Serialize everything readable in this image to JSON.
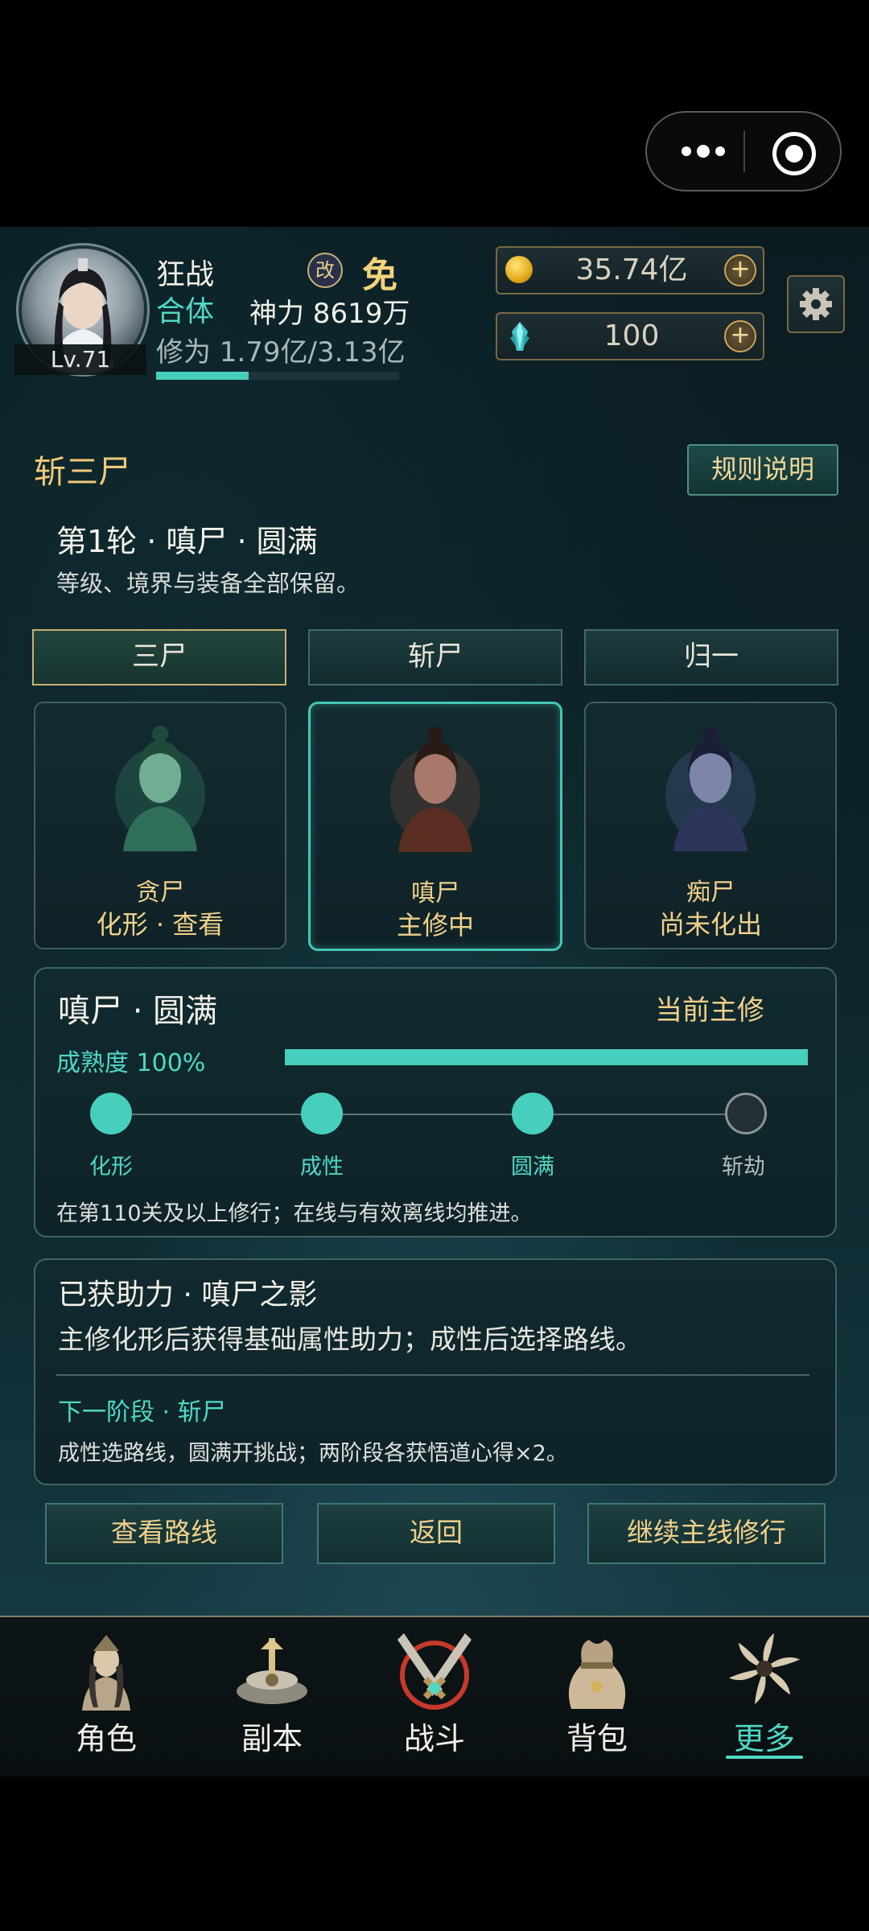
{
  "player": {
    "name": "狂战",
    "level": "Lv.71",
    "realm": "合体",
    "power": "神力 8619万",
    "cultivation": "修为 1.79亿/3.13亿",
    "cultivation_progress": 0.38,
    "gai_label": "改",
    "mian_label": "免"
  },
  "resources": {
    "gold": "35.74亿",
    "gems": "100",
    "plus": "+"
  },
  "section": {
    "title": "斩三尸",
    "rules_button": "规则说明",
    "round": "第1轮 · 嗔尸 · 圆满",
    "round_desc": "等级、境界与装备全部保留。"
  },
  "tabs": [
    {
      "label": "三尸",
      "active": true
    },
    {
      "label": "斩尸",
      "active": false
    },
    {
      "label": "归一",
      "active": false
    }
  ],
  "corpses": [
    {
      "name": "贪尸",
      "status": "化形 · 查看",
      "color": "#3f9a78",
      "active": false
    },
    {
      "name": "嗔尸",
      "status": "主修中",
      "color": "#a8553b",
      "active": true
    },
    {
      "name": "痴尸",
      "status": "尚未化出",
      "color": "#5a6ab0",
      "active": false
    }
  ],
  "current_panel": {
    "title": "嗔尸 · 圆满",
    "current_label": "当前主修",
    "maturity_label": "成熟度 100%",
    "maturity": 1.0,
    "stages": [
      {
        "label": "化形",
        "done": true
      },
      {
        "label": "成性",
        "done": true
      },
      {
        "label": "圆满",
        "done": true
      },
      {
        "label": "斩劫",
        "done": false
      }
    ],
    "desc": "在第110关及以上修行；在线与有效离线均推进。"
  },
  "aid_panel": {
    "title": "已获助力 · 嗔尸之影",
    "desc": "主修化形后获得基础属性助力；成性后选择路线。",
    "next": "下一阶段 · 斩尸",
    "next_desc": "成性选路线，圆满开挑战；两阶段各获悟道心得×2。"
  },
  "buttons": {
    "route": "查看路线",
    "back": "返回",
    "continue": "继续主线修行"
  },
  "nav": [
    {
      "label": "角色",
      "icon": "character-icon",
      "active": false
    },
    {
      "label": "副本",
      "icon": "dungeon-icon",
      "active": false
    },
    {
      "label": "战斗",
      "icon": "battle-icon",
      "active": false
    },
    {
      "label": "背包",
      "icon": "bag-icon",
      "active": false
    },
    {
      "label": "更多",
      "icon": "more-icon",
      "active": true
    }
  ]
}
